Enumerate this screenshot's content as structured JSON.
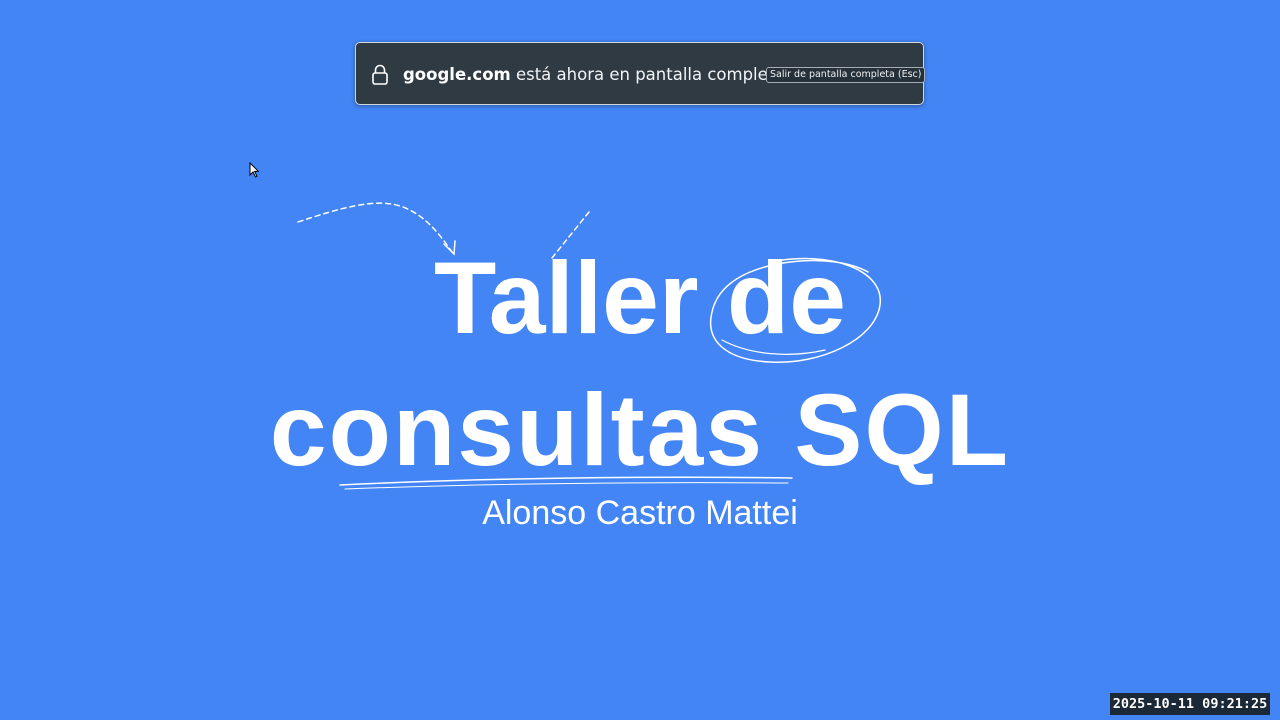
{
  "fullscreen_notice": {
    "domain": "google.com",
    "message": " está ahora en pantalla completa",
    "exit_label": "Salir de pantalla completa (Esc)"
  },
  "slide": {
    "title_line1": "Taller de",
    "title_line2": "consultas SQL",
    "author": "Alonso Castro Mattei",
    "background_color": "#4385f4"
  },
  "overlay": {
    "timestamp": "2025-10-11  09:21:25"
  },
  "icons": [
    "lock-icon",
    "mouse-cursor-icon"
  ]
}
